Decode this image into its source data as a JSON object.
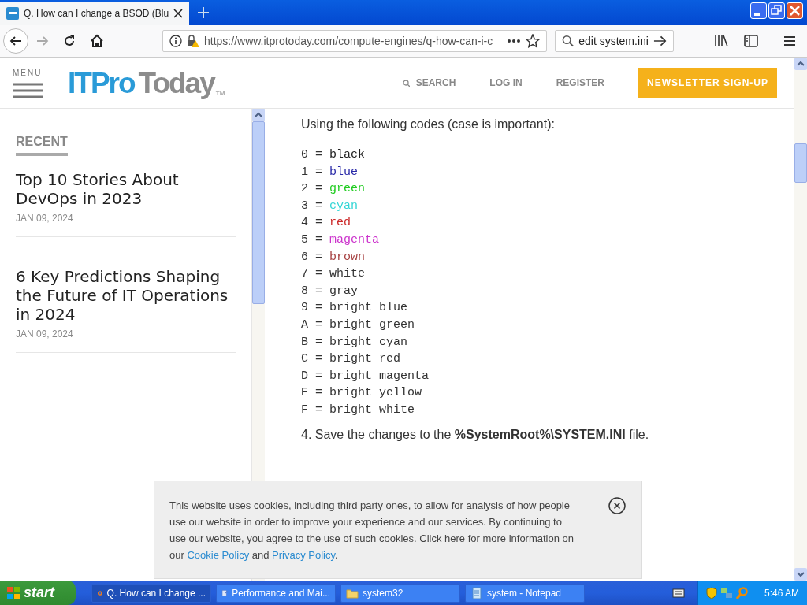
{
  "browser": {
    "tab": {
      "title": "Q. How can I change a BSOD (Blu",
      "selected": true
    },
    "url": "https://www.itprotoday.com/compute-engines/q-how-can-i-c",
    "search": {
      "value": "edit system.ini"
    }
  },
  "site": {
    "menu_label": "MENU",
    "logo": {
      "part1": "ITPro",
      "part2": "Today",
      "tm": "TM"
    },
    "nav": [
      "SEARCH",
      "LOG IN",
      "REGISTER"
    ],
    "newsletter": "NEWSLETTER SIGN-UP"
  },
  "sidebar": {
    "heading": "RECENT",
    "articles": [
      {
        "title": "Top 10 Stories About DevOps in 2023",
        "date": "JAN 09, 2024"
      },
      {
        "title": "6 Key Predictions Shaping the Future of IT Operations in 2024",
        "date": "JAN 09, 2024"
      }
    ]
  },
  "article": {
    "intro": "Using the following codes (case is important):",
    "codes": [
      {
        "code": "0 =",
        "name": "black",
        "color": "#222222"
      },
      {
        "code": "1 =",
        "name": "blue",
        "color": "#2a2aa8"
      },
      {
        "code": "2 =",
        "name": "green",
        "color": "#22cc22"
      },
      {
        "code": "3 =",
        "name": "cyan",
        "color": "#33d6d6"
      },
      {
        "code": "4 =",
        "name": "red",
        "color": "#cc2a2a"
      },
      {
        "code": "5 =",
        "name": "magenta",
        "color": "#cc33cc"
      },
      {
        "code": "6 =",
        "name": "brown",
        "color": "#a84444"
      },
      {
        "code": "7 =",
        "name": "white",
        "color": "#333333"
      },
      {
        "code": "8 =",
        "name": "gray",
        "color": "#333333"
      },
      {
        "code": "9 =",
        "name": "bright blue",
        "color": "#333333"
      },
      {
        "code": "A =",
        "name": "bright green",
        "color": "#333333"
      },
      {
        "code": "B =",
        "name": "bright cyan",
        "color": "#333333"
      },
      {
        "code": "C =",
        "name": "bright red",
        "color": "#333333"
      },
      {
        "code": "D =",
        "name": "bright magenta",
        "color": "#333333"
      },
      {
        "code": "E =",
        "name": "bright yellow",
        "color": "#333333"
      },
      {
        "code": "F =",
        "name": "bright white",
        "color": "#333333"
      }
    ],
    "step4": "4. Save the changes to the **%SystemRoot%\\SYSTEM.INI** file."
  },
  "cookie_banner": {
    "text": "This website uses cookies, including third party ones, to allow for analysis of how people use our website in order to improve your experience and our services. By continuing to use our website, you agree to the use of such cookies. Click here for more information on our ",
    "links": [
      "Cookie Policy",
      "Privacy Policy"
    ],
    "joiner": " and ",
    "end": "."
  },
  "taskbar": {
    "start": "start",
    "items": [
      {
        "label": "Q. How can I change ...",
        "selected": true
      },
      {
        "label": "Performance and Mai...",
        "selected": false
      },
      {
        "label": "system32",
        "selected": false
      },
      {
        "label": "system - Notepad",
        "selected": false
      }
    ],
    "clock": "5:46 AM"
  }
}
